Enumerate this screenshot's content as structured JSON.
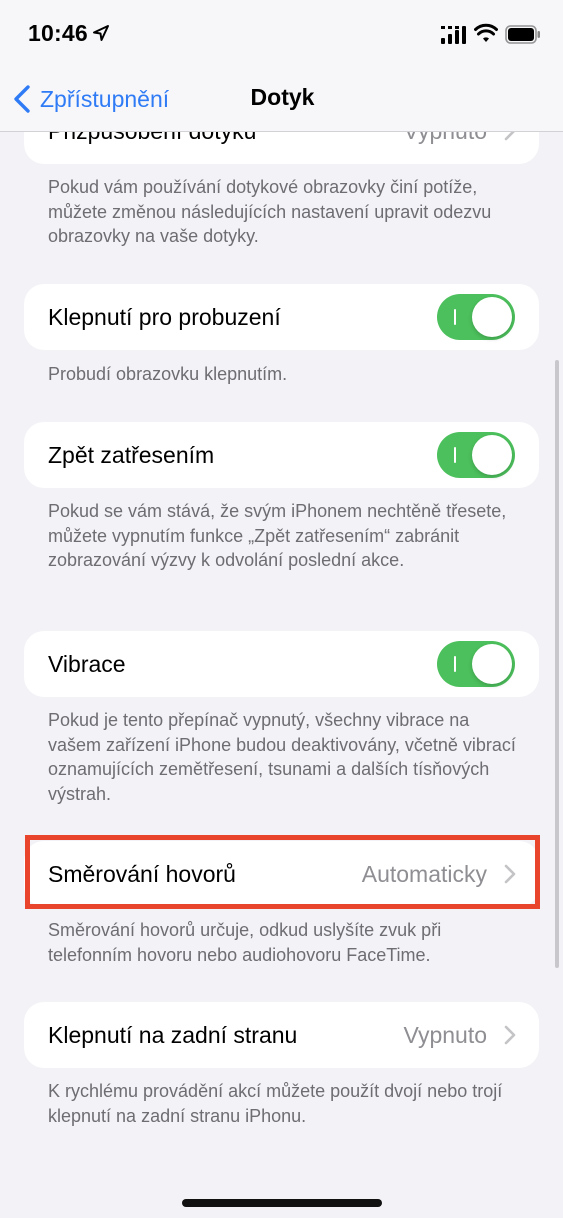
{
  "status_bar": {
    "time": "10:46",
    "icons": [
      "location-arrow-icon",
      "cellular-signal-icon",
      "wifi-icon",
      "battery-icon"
    ]
  },
  "nav": {
    "back_label": "Zpřístupnění",
    "title": "Dotyk"
  },
  "colors": {
    "accent": "#2f7bf6",
    "toggle_on": "#4cc05c",
    "highlight": "#e8452c",
    "background": "#f2f2f7"
  },
  "sections": {
    "touch_accommodations": {
      "label": "Přizpůsobení dotyku",
      "value": "Vypnuto",
      "footer": "Pokud vám používání dotykové obrazovky činí potíže, můžete změnou následujících nastavení upravit odezvu obrazovky na vaše dotyky."
    },
    "tap_to_wake": {
      "label": "Klepnutí pro probuzení",
      "toggle": "on",
      "footer": "Probudí obrazovku klepnutím."
    },
    "shake_to_undo": {
      "label": "Zpět zatřesením",
      "toggle": "on",
      "footer": "Pokud se vám stává, že svým iPhonem nechtěně třesete, můžete vypnutím funkce „Zpět zatřesením“ zabránit zobrazování výzvy k odvolání poslední akce."
    },
    "vibration": {
      "label": "Vibrace",
      "toggle": "on",
      "footer": "Pokud je tento přepínač vypnutý, všechny vibrace na vašem zařízení iPhone budou deaktivovány, včetně vibrací oznamujících zemětřesení, tsunami a dalších tísňových výstrah."
    },
    "call_audio_routing": {
      "label": "Směrování hovorů",
      "value": "Automaticky",
      "footer": "Směrování hovorů určuje, odkud uslyšíte zvuk při telefonním hovoru nebo audiohovoru FaceTime."
    },
    "back_tap": {
      "label": "Klepnutí na zadní stranu",
      "value": "Vypnuto",
      "footer": "K rychlému provádění akcí můžete použít dvojí nebo trojí klepnutí na zadní stranu iPhonu."
    }
  }
}
